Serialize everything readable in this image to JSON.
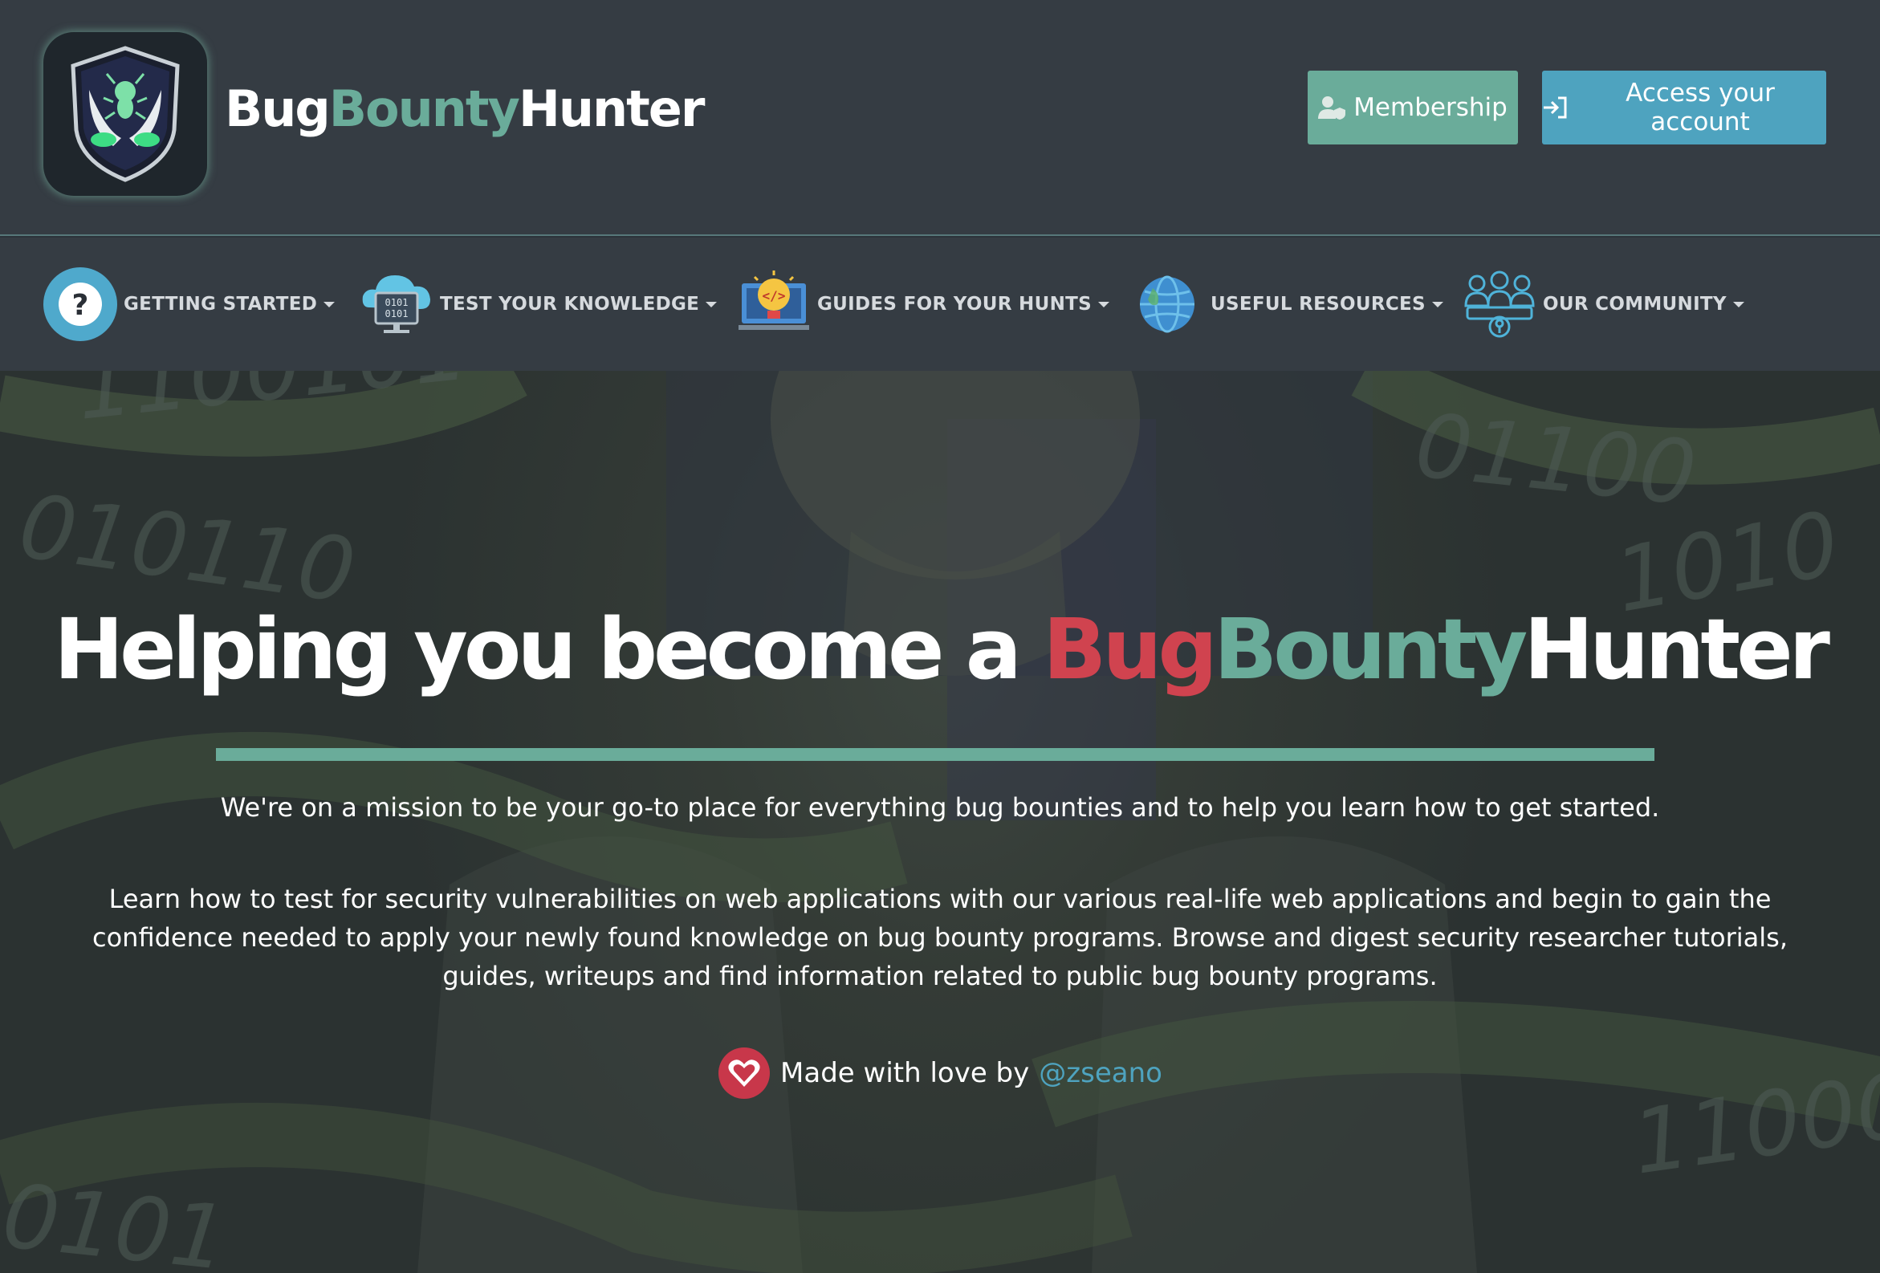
{
  "brand": {
    "part1": "Bug",
    "part2": "Bounty",
    "part3": "Hunter",
    "logo_icon": "bug-shield-mascot-icon"
  },
  "header": {
    "membership_label": "Membership",
    "membership_icon": "user-shield-icon",
    "account_label": "Access your account",
    "account_icon": "sign-in-icon"
  },
  "nav": {
    "items": [
      {
        "label": "GETTING STARTED",
        "icon": "question-circle-icon"
      },
      {
        "label": "TEST YOUR KNOWLEDGE",
        "icon": "cloud-computer-icon"
      },
      {
        "label": "GUIDES FOR YOUR HUNTS",
        "icon": "lightbulb-code-icon"
      },
      {
        "label": "USEFUL RESOURCES",
        "icon": "globe-icon"
      },
      {
        "label": "OUR COMMUNITY",
        "icon": "community-people-icon"
      }
    ]
  },
  "hero": {
    "title_prefix": "Helping you become a ",
    "title_bug": "Bug",
    "title_bounty": "Bounty",
    "title_hunter": "Hunter",
    "mission": "We're on a mission to be your go-to place for everything bug bounties and to help you learn how to get started.",
    "learn": "Learn how to test for security vulnerabilities on web applications with our various real-life web applications and begin to gain the confidence needed to apply your newly found knowledge on bug bounty programs. Browse and digest security researcher tutorials, guides, writeups and find information related to public bug bounty programs.",
    "made_text": "Made with love by",
    "made_link": "@zseano",
    "heart_icon": "heart-icon"
  },
  "colors": {
    "brand_green": "#6aac9a",
    "brand_red": "#d0434f",
    "account_blue": "#4ea3bf",
    "header_bg": "#353c43"
  }
}
